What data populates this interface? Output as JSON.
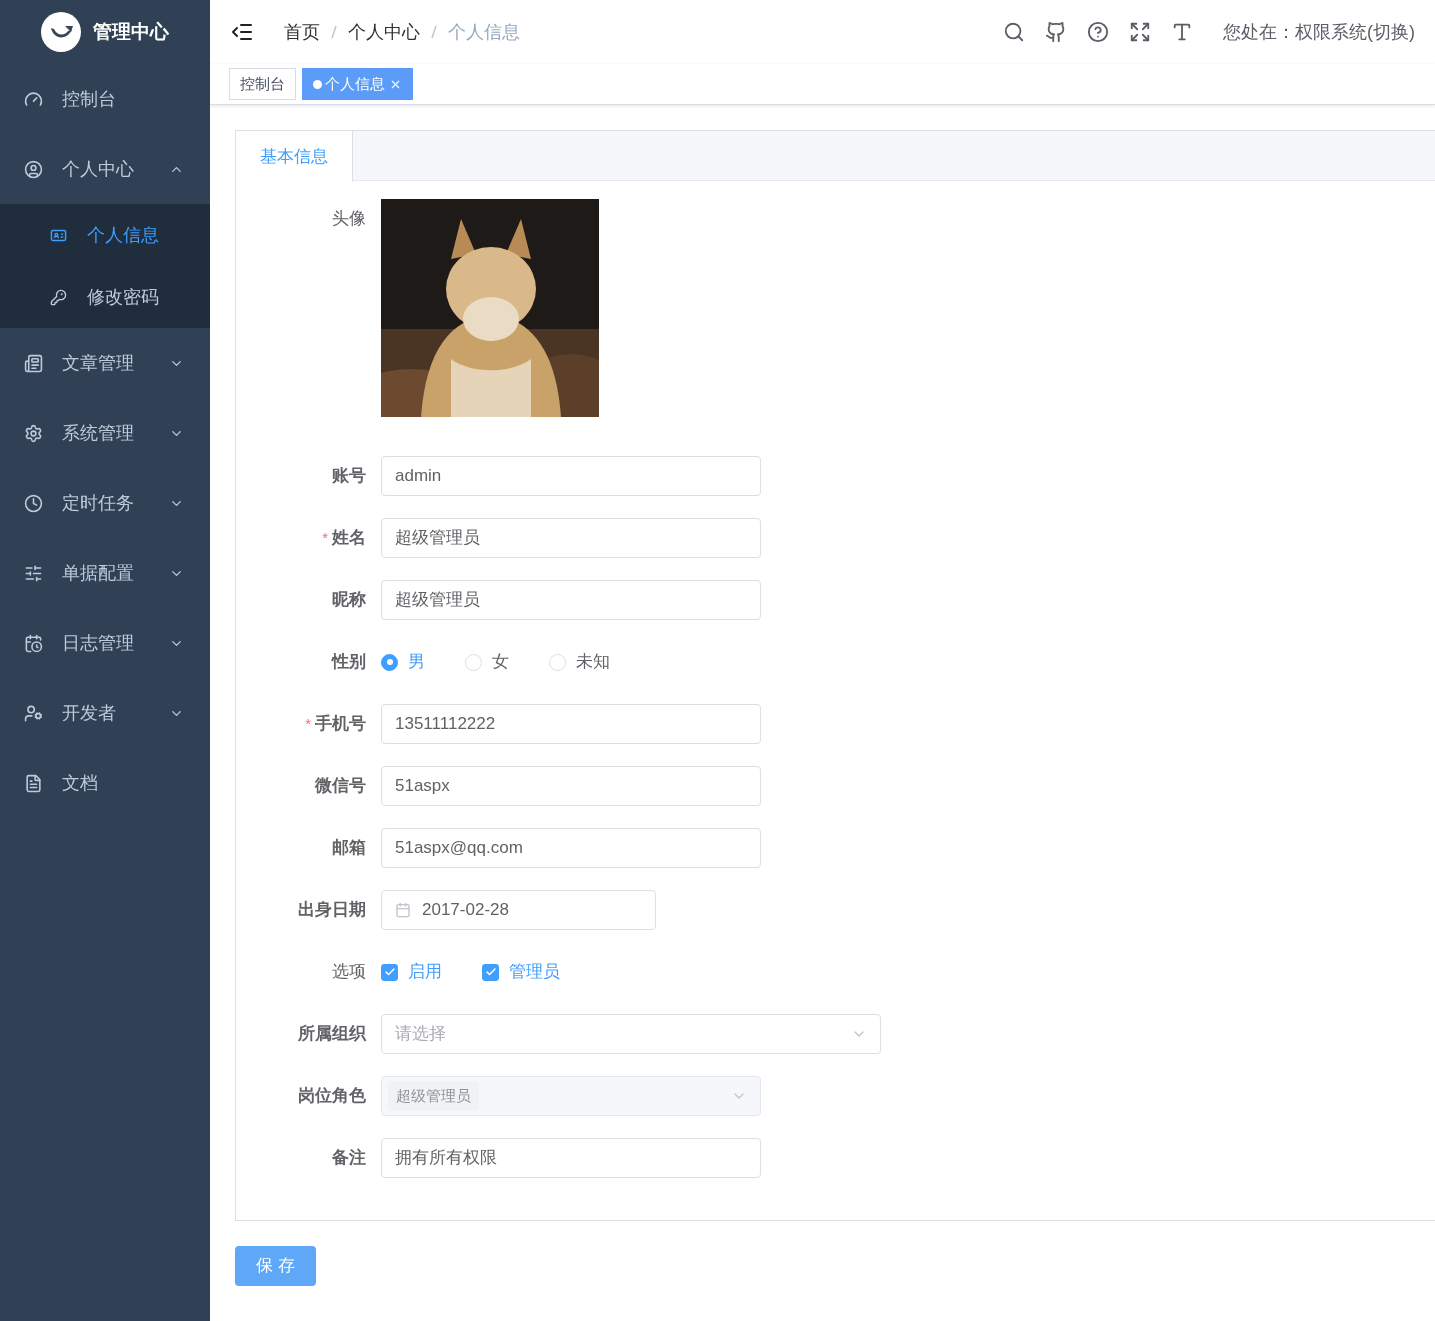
{
  "sidebar": {
    "title": "管理中心",
    "items": [
      {
        "label": "控制台",
        "selected": false
      },
      {
        "label": "个人中心",
        "selected": false,
        "expanded": true,
        "children": [
          {
            "label": "个人信息",
            "selected": true
          },
          {
            "label": "修改密码",
            "selected": false
          }
        ]
      },
      {
        "label": "文章管理",
        "selected": false,
        "expanded": false
      },
      {
        "label": "系统管理",
        "selected": false,
        "expanded": false
      },
      {
        "label": "定时任务",
        "selected": false,
        "expanded": false
      },
      {
        "label": "单据配置",
        "selected": false,
        "expanded": false
      },
      {
        "label": "日志管理",
        "selected": false,
        "expanded": false
      },
      {
        "label": "开发者",
        "selected": false,
        "expanded": false
      },
      {
        "label": "文档",
        "selected": false
      }
    ]
  },
  "header": {
    "breadcrumb": [
      "首页",
      "个人中心",
      "个人信息"
    ],
    "location": "您处在：权限系统(切换)"
  },
  "tags": [
    {
      "label": "控制台",
      "selected": false
    },
    {
      "label": "个人信息",
      "selected": true
    }
  ],
  "form": {
    "tabs": [
      {
        "label": "基本信息",
        "selected": true
      }
    ],
    "fields": [
      {
        "kind": "avatar",
        "label": "头像",
        "bold": false
      },
      {
        "kind": "text",
        "label": "账号",
        "bold": true,
        "value": "admin"
      },
      {
        "kind": "text",
        "label": "姓名",
        "bold": true,
        "required_mark": "*",
        "value": "超级管理员"
      },
      {
        "kind": "text",
        "label": "昵称",
        "bold": true,
        "value": "超级管理员"
      },
      {
        "kind": "radio",
        "label": "性别",
        "bold": true,
        "options": [
          {
            "label": "男",
            "selected": true
          },
          {
            "label": "女",
            "selected": false
          },
          {
            "label": "未知",
            "selected": false
          }
        ]
      },
      {
        "kind": "text",
        "label": "手机号",
        "bold": true,
        "required_mark": "*",
        "value": "13511112222"
      },
      {
        "kind": "text",
        "label": "微信号",
        "bold": true,
        "value": "51aspx"
      },
      {
        "kind": "text",
        "label": "邮箱",
        "bold": true,
        "value": "51aspx@qq.com"
      },
      {
        "kind": "date",
        "label": "出身日期",
        "bold": true,
        "value": "2017-02-28"
      },
      {
        "kind": "checkbox",
        "label": "选项",
        "bold": false,
        "options": [
          {
            "label": "启用",
            "checked": true
          },
          {
            "label": "管理员",
            "checked": true
          }
        ]
      },
      {
        "kind": "select",
        "label": "所属组织",
        "bold": true,
        "placeholder": "请选择"
      },
      {
        "kind": "tags-select",
        "label": "岗位角色",
        "bold": true,
        "disabled": true,
        "tags": [
          "超级管理员"
        ]
      },
      {
        "kind": "text",
        "label": "备注",
        "bold": true,
        "value": "拥有所有权限"
      }
    ]
  },
  "save_button": "保 存"
}
